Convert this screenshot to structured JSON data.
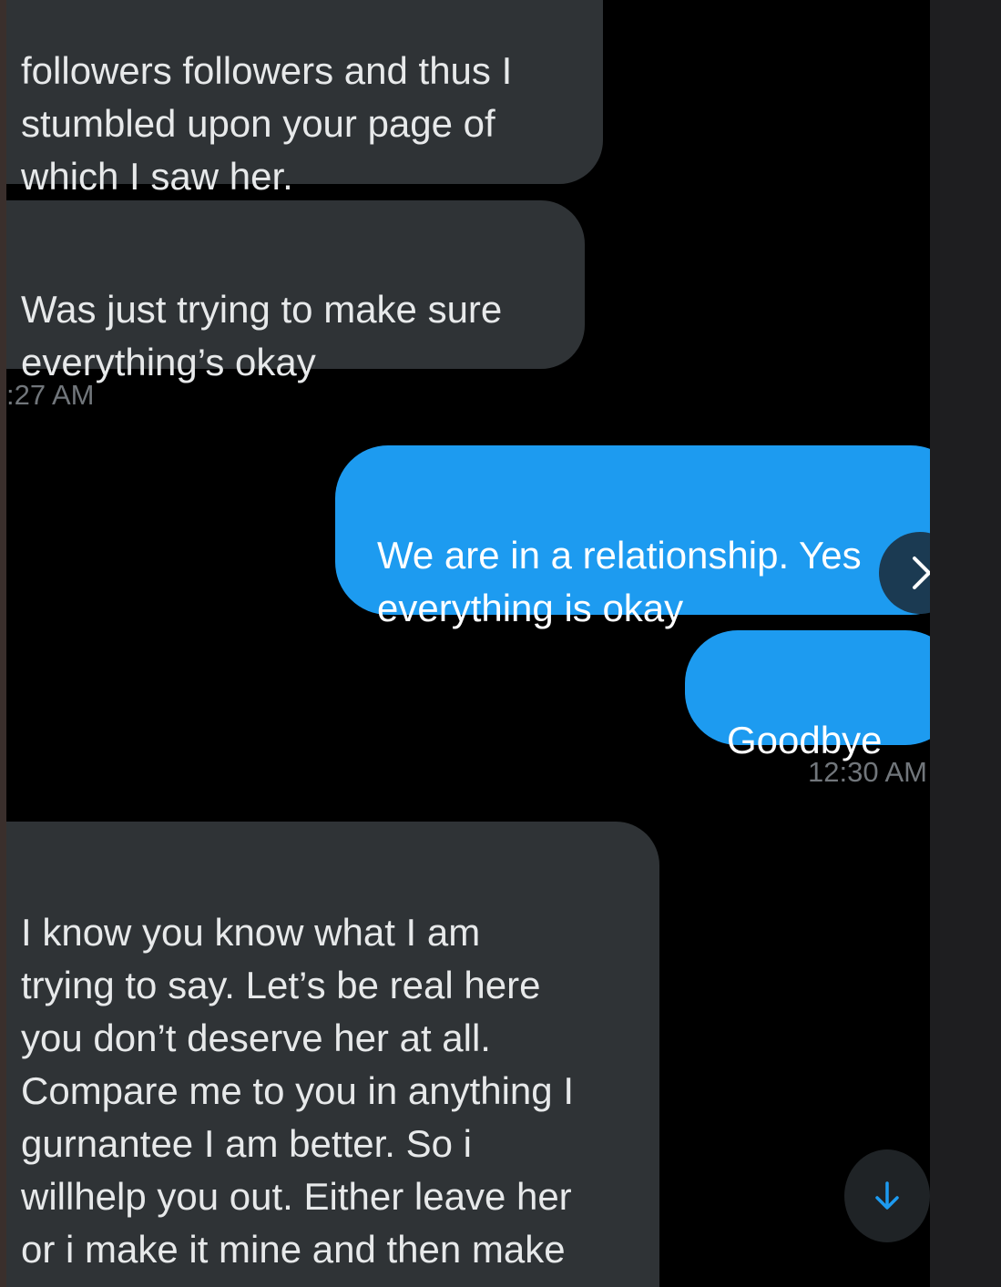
{
  "messages": [
    {
      "direction": "incoming",
      "text": "followers followers and thus I\nstumbled upon your page of\nwhich I saw her."
    },
    {
      "direction": "incoming",
      "text": "Was just trying to make sure\neverything’s okay"
    },
    {
      "direction": "outgoing",
      "text": "We are in a relationship. Yes\neverything is okay"
    },
    {
      "direction": "outgoing",
      "text": "Goodbye"
    },
    {
      "direction": "incoming",
      "text": "I know you know what I am\ntrying to say. Let’s be real here\nyou don’t deserve her at all.\nCompare me to you in anything I\ngurnantee I am better. So i\nwillhelp you out. Either leave her\nor i make it mine  and then make\nyou depressed."
    }
  ],
  "timestamps": {
    "incoming_group": ":27 AM",
    "outgoing_group": "12:30 AM"
  },
  "icons": {
    "next": "chevron-right-icon",
    "scroll": "arrow-down-icon"
  },
  "colors": {
    "background": "#000000",
    "incoming_bubble": "#2f3336",
    "outgoing_bubble": "#1d9bf0",
    "timestamp": "#71767b",
    "accent": "#1d9bf0"
  }
}
